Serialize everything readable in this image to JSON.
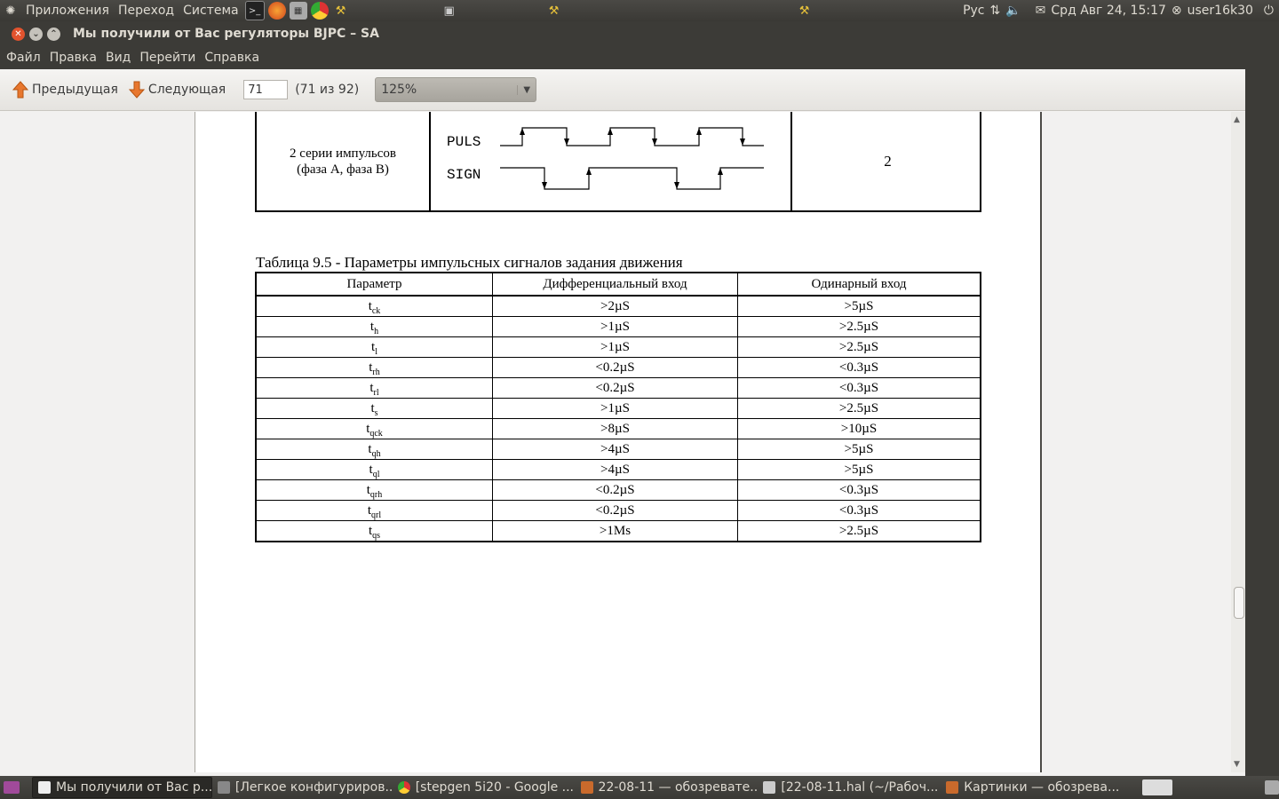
{
  "top_panel": {
    "menus": [
      "Приложения",
      "Переход",
      "Система"
    ],
    "keyboard": "Рус",
    "datetime": "Срд Авг 24, 15:17",
    "user": "user16k30"
  },
  "window": {
    "title": "Мы получили от Вас регуляторы BJPC – SA",
    "menu": [
      "Файл",
      "Правка",
      "Вид",
      "Перейти",
      "Справка"
    ]
  },
  "toolbar": {
    "prev_label": "Предыдущая",
    "next_label": "Следующая",
    "page_value": "71",
    "page_count": "(71 из 92)",
    "zoom_value": "125%"
  },
  "document": {
    "signal_row": {
      "description_line1": "2 серии импульсов",
      "description_line2": "(фаза A, фаза B)",
      "label_puls": "PULS",
      "label_sign": "SIGN",
      "value": "2"
    },
    "table_caption": "Таблица 9.5 - Параметры импульсных сигналов задания движения",
    "table_headers": [
      "Параметр",
      "Дифференциальный вход",
      "Одинарный вход"
    ],
    "table_rows": [
      {
        "param": "t",
        "sub": "ck",
        "diff": ">2µS",
        "single": ">5µS"
      },
      {
        "param": "t",
        "sub": "h",
        "diff": ">1µS",
        "single": ">2.5µS"
      },
      {
        "param": "t",
        "sub": "l",
        "diff": ">1µS",
        "single": ">2.5µS"
      },
      {
        "param": "t",
        "sub": "rh",
        "diff": "<0.2µS",
        "single": "<0.3µS"
      },
      {
        "param": "t",
        "sub": "rl",
        "diff": "<0.2µS",
        "single": "<0.3µS"
      },
      {
        "param": "t",
        "sub": "s",
        "diff": ">1µS",
        "single": ">2.5µS"
      },
      {
        "param": "t",
        "sub": "qck",
        "diff": ">8µS",
        "single": ">10µS"
      },
      {
        "param": "t",
        "sub": "qh",
        "diff": ">4µS",
        "single": ">5µS"
      },
      {
        "param": "t",
        "sub": "ql",
        "diff": ">4µS",
        "single": ">5µS"
      },
      {
        "param": "t",
        "sub": "qrh",
        "diff": "<0.2µS",
        "single": "<0.3µS"
      },
      {
        "param": "t",
        "sub": "qrl",
        "diff": "<0.2µS",
        "single": "<0.3µS"
      },
      {
        "param": "t",
        "sub": "qs",
        "diff": ">1Ms",
        "single": ">2.5µS"
      }
    ]
  },
  "taskbar": {
    "items": [
      "Мы получили от Вас р...",
      "[Легкое конфигуриров...",
      "[stepgen 5i20 - Google ...",
      "22-08-11 — обозревате...",
      "[22-08-11.hal (~/Рабоч...",
      "Картинки — обозрева..."
    ]
  }
}
